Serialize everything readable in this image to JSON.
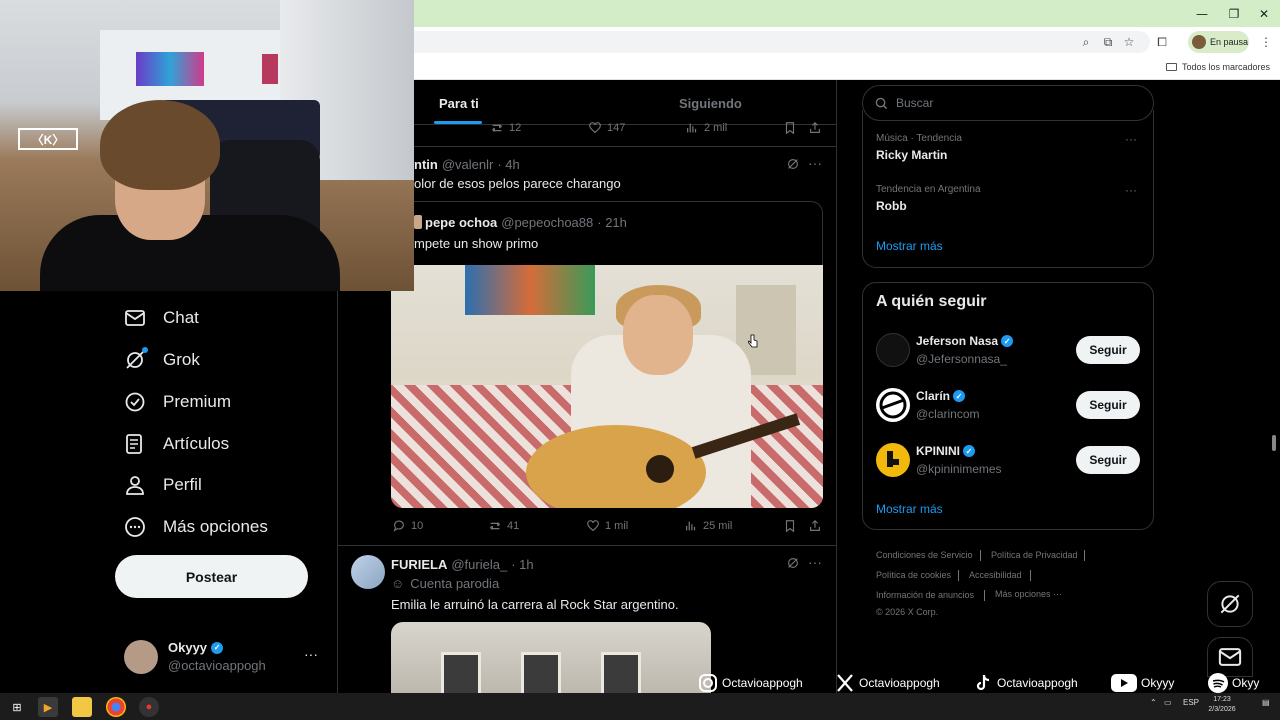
{
  "browser": {
    "profile_status": "En pausa",
    "bookmarks_label": "Todos los marcadores"
  },
  "tabs": {
    "for_you": "Para ti",
    "following": "Siguiendo"
  },
  "nav": {
    "items": [
      {
        "label": "Chat",
        "icon": "mail-icon"
      },
      {
        "label": "Grok",
        "icon": "grok-icon"
      },
      {
        "label": "Premium",
        "icon": "verified-badge-icon"
      },
      {
        "label": "Artículos",
        "icon": "articles-icon"
      },
      {
        "label": "Perfil",
        "icon": "person-icon"
      },
      {
        "label": "Más opciones",
        "icon": "more-circle-icon"
      }
    ],
    "post_button": "Postear"
  },
  "account": {
    "name": "Okyyy",
    "handle": "@octavioappogh",
    "more": "···"
  },
  "feed": {
    "top_actions": {
      "retweets": "12",
      "likes": "147",
      "views": "2 mil"
    },
    "post1": {
      "name": "ntin",
      "handle": "@valenlr",
      "time": "· 4h",
      "text": "olor de esos pelos parece charango",
      "quote": {
        "name": "pepe ochoa",
        "handle": "@pepeochoa88",
        "time": "· 21h",
        "text": "mpete un show primo"
      },
      "actions": {
        "replies": "10",
        "retweets": "41",
        "likes": "1 mil",
        "views": "25 mil"
      }
    },
    "post2": {
      "name": "FURIELA",
      "handle": "@furiela_",
      "time": "· 1h",
      "badge": "Cuenta parodia",
      "text": "Emilia le arruinó la carrera al Rock Star argentino."
    }
  },
  "sidebar": {
    "search_placeholder": "Buscar",
    "trends": [
      {
        "context": "Música · Tendencia",
        "title": "Ricky Martin"
      },
      {
        "context": "Tendencia en Argentina",
        "title": "Robb"
      }
    ],
    "trends_show_more": "Mostrar más",
    "who_to_follow": {
      "heading": "A quién seguir",
      "accounts": [
        {
          "name": "Jeferson Nasa",
          "handle": "@Jefersonnasa_",
          "button": "Seguir"
        },
        {
          "name": "Clarín",
          "handle": "@clarincom",
          "button": "Seguir"
        },
        {
          "name": "KPININI",
          "handle": "@kpininimemes",
          "button": "Seguir"
        }
      ],
      "show_more": "Mostrar más"
    },
    "footer": {
      "terms": "Condiciones de Servicio",
      "privacy": "Política de Privacidad",
      "cookies": "Política de cookies",
      "accessibility": "Accesibilidad",
      "ads": "Información de anuncios",
      "more": "Más opciones ···",
      "copyright": "© 2026 X Corp."
    }
  },
  "overlay": {
    "instagram": "Octavioappogh",
    "x": "Octavioappogh",
    "tiktok": "Octavioappogh",
    "youtube": "Okyyy",
    "spotify": "Okyy"
  },
  "taskbar": {
    "lang": "ESP",
    "time": "17:23",
    "date": "2/3/2026"
  },
  "colors": {
    "accent": "#1d9bf0",
    "background": "#000000",
    "text": "#e7e9ea",
    "muted": "#71767b"
  }
}
